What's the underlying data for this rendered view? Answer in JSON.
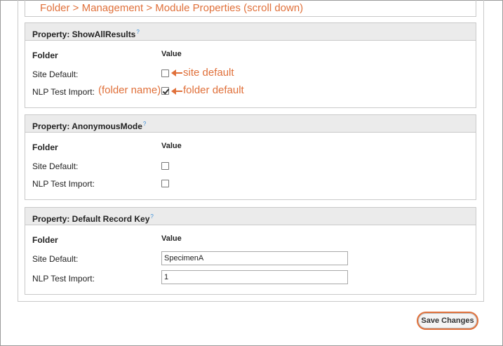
{
  "annotations": {
    "breadcrumb": "Folder > Management > Module Properties (scroll down)",
    "site_default": "site default",
    "folder_name": "(folder name)",
    "folder_default": "folder default"
  },
  "columns": {
    "folder": "Folder",
    "value": "Value"
  },
  "help_mark": "?",
  "properties": [
    {
      "title": "Property: ShowAllResults",
      "rows": [
        {
          "label": "Site Default:",
          "checked": false
        },
        {
          "label": "NLP Test Import:",
          "checked": true
        }
      ]
    },
    {
      "title": "Property: AnonymousMode",
      "rows": [
        {
          "label": "Site Default:",
          "checked": false
        },
        {
          "label": "NLP Test Import:",
          "checked": false
        }
      ]
    },
    {
      "title": "Property: Default Record Key",
      "rows": [
        {
          "label": "Site Default:",
          "value": "SpecimenA"
        },
        {
          "label": "NLP Test Import:",
          "value": "1"
        }
      ]
    }
  ],
  "buttons": {
    "save": "Save Changes"
  },
  "colors": {
    "annotation": "#e0703a",
    "header_bg": "#ebebeb",
    "border": "#c9c9c9"
  }
}
